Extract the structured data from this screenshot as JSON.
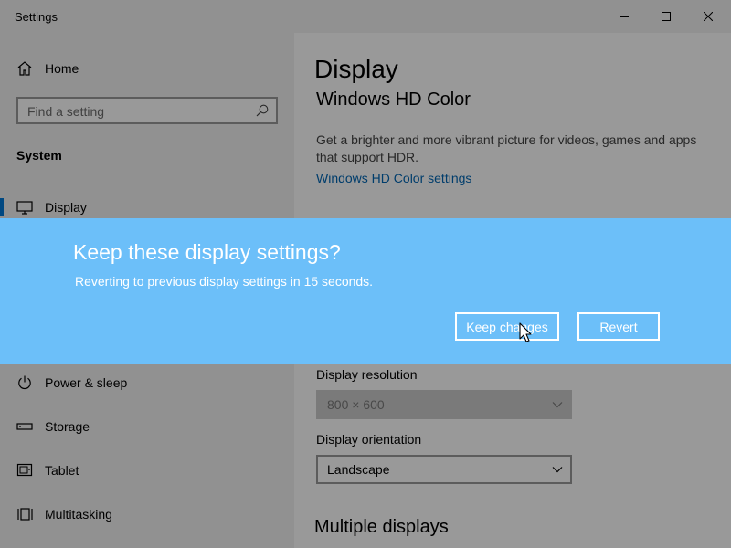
{
  "window": {
    "title": "Settings",
    "controls": {
      "minimize": "minimize-icon",
      "maximize": "maximize-icon",
      "close": "close-icon"
    }
  },
  "sidebar": {
    "home_label": "Home",
    "search": {
      "placeholder": "Find a setting"
    },
    "section_label": "System",
    "items": [
      {
        "label": "Display",
        "icon": "monitor-icon",
        "selected": true
      },
      {
        "label": "Power & sleep",
        "icon": "power-icon"
      },
      {
        "label": "Storage",
        "icon": "storage-icon"
      },
      {
        "label": "Tablet",
        "icon": "tablet-icon"
      },
      {
        "label": "Multitasking",
        "icon": "multitasking-icon"
      }
    ]
  },
  "main": {
    "title": "Display",
    "hd_color": {
      "heading": "Windows HD Color",
      "description": "Get a brighter and more vibrant picture for videos, games and apps that support HDR.",
      "link": "Windows HD Color settings"
    },
    "resolution": {
      "label": "Display resolution",
      "value": "800 × 600",
      "disabled": true
    },
    "orientation": {
      "label": "Display orientation",
      "value": "Landscape"
    },
    "multiple_displays_heading": "Multiple displays"
  },
  "dialog": {
    "title": "Keep these display settings?",
    "message": "Reverting to previous display settings in 15 seconds.",
    "keep_label": "Keep changes",
    "revert_label": "Revert"
  },
  "colors": {
    "dialog_background": "#6cbff9",
    "accent": "#0078d7",
    "link": "#0066b4"
  }
}
